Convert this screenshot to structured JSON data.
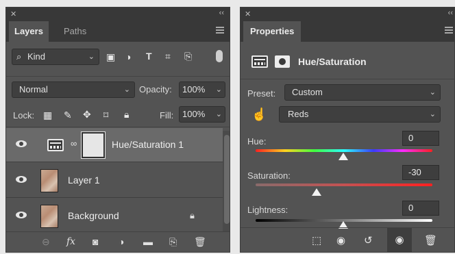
{
  "layers_panel": {
    "tabs": [
      "Layers",
      "Paths"
    ],
    "filter": {
      "label": "Kind"
    },
    "blend_mode": "Normal",
    "opacity": {
      "label": "Opacity:",
      "value": "100%"
    },
    "lock_label": "Lock:",
    "fill": {
      "label": "Fill:",
      "value": "100%"
    },
    "layers": [
      {
        "name": "Hue/Saturation 1"
      },
      {
        "name": "Layer 1"
      },
      {
        "name": "Background"
      }
    ],
    "fx_label": "fx"
  },
  "properties_panel": {
    "tab": "Properties",
    "adjustment_title": "Hue/Saturation",
    "preset": {
      "label": "Preset:",
      "value": "Custom"
    },
    "range": {
      "value": "Reds"
    },
    "hue": {
      "label": "Hue:",
      "value": "0"
    },
    "saturation": {
      "label": "Saturation:",
      "value": "-30"
    },
    "lightness": {
      "label": "Lightness:",
      "value": "0"
    }
  },
  "colors": {
    "panel_bg": "#535353",
    "tab_bar_bg": "#383838",
    "field_bg": "#3f3f3f",
    "selected_row": "#6a6a6a",
    "page_bg": "#e9e9e9"
  }
}
